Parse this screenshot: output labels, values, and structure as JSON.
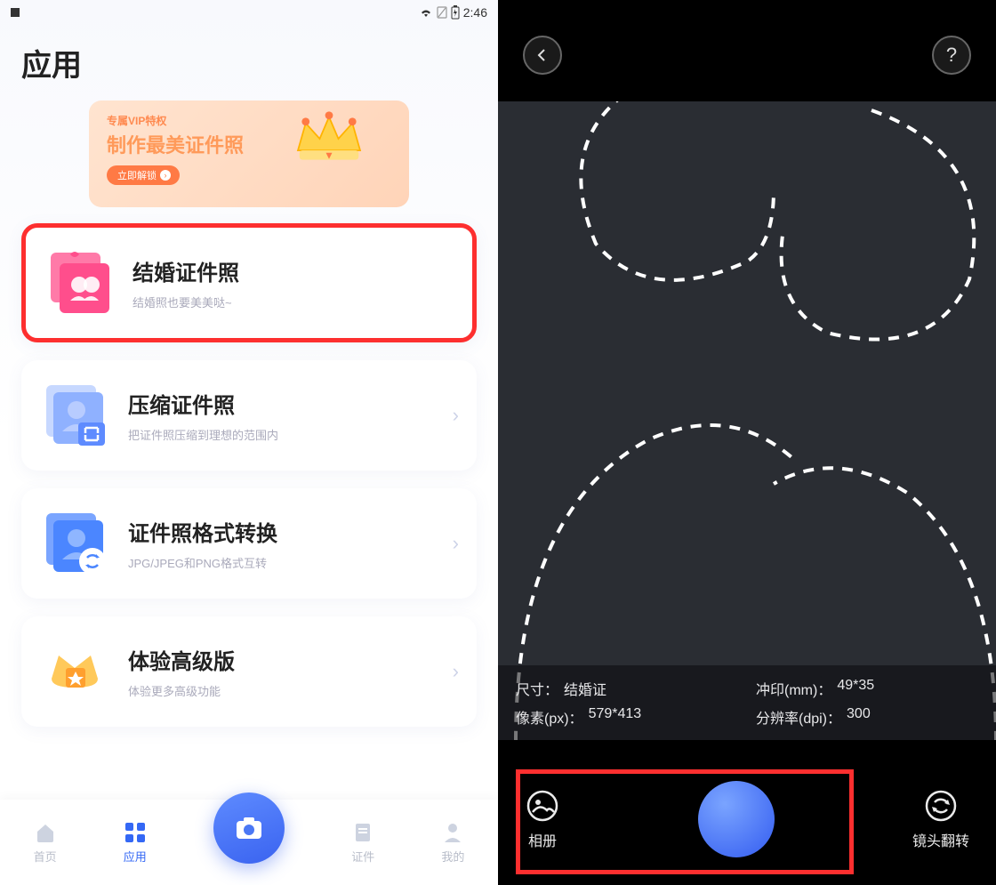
{
  "status": {
    "time": "2:46"
  },
  "page": {
    "title": "应用"
  },
  "vip": {
    "tag": "专属VIP特权",
    "title": "制作最美证件照",
    "button": "立即解锁"
  },
  "cards": [
    {
      "title": "结婚证件照",
      "desc": "结婚照也要美美哒~",
      "icon_color": "#ff5b9c",
      "highlighted": true,
      "show_chevron": false
    },
    {
      "title": "压缩证件照",
      "desc": "把证件照压缩到理想的范围内",
      "icon_color": "#7aa5ff",
      "highlighted": false,
      "show_chevron": true
    },
    {
      "title": "证件照格式转换",
      "desc": "JPG/JPEG和PNG格式互转",
      "icon_color": "#4b86ff",
      "highlighted": false,
      "show_chevron": true
    },
    {
      "title": "体验高级版",
      "desc": "体验更多高级功能",
      "icon_color": "#ffb94a",
      "highlighted": false,
      "show_chevron": true
    }
  ],
  "nav": {
    "items": [
      {
        "label": "首页",
        "active": false
      },
      {
        "label": "应用",
        "active": true
      },
      {
        "label": "证件",
        "active": false
      },
      {
        "label": "我的",
        "active": false
      }
    ]
  },
  "camera": {
    "info": {
      "size_label": "尺寸：",
      "size_value": "结婚证",
      "print_label": "冲印(mm)：",
      "print_value": "49*35",
      "pixel_label": "像素(px)：",
      "pixel_value": "579*413",
      "dpi_label": "分辨率(dpi)：",
      "dpi_value": "300"
    },
    "bottom": {
      "gallery": "相册",
      "flip": "镜头翻转"
    }
  }
}
